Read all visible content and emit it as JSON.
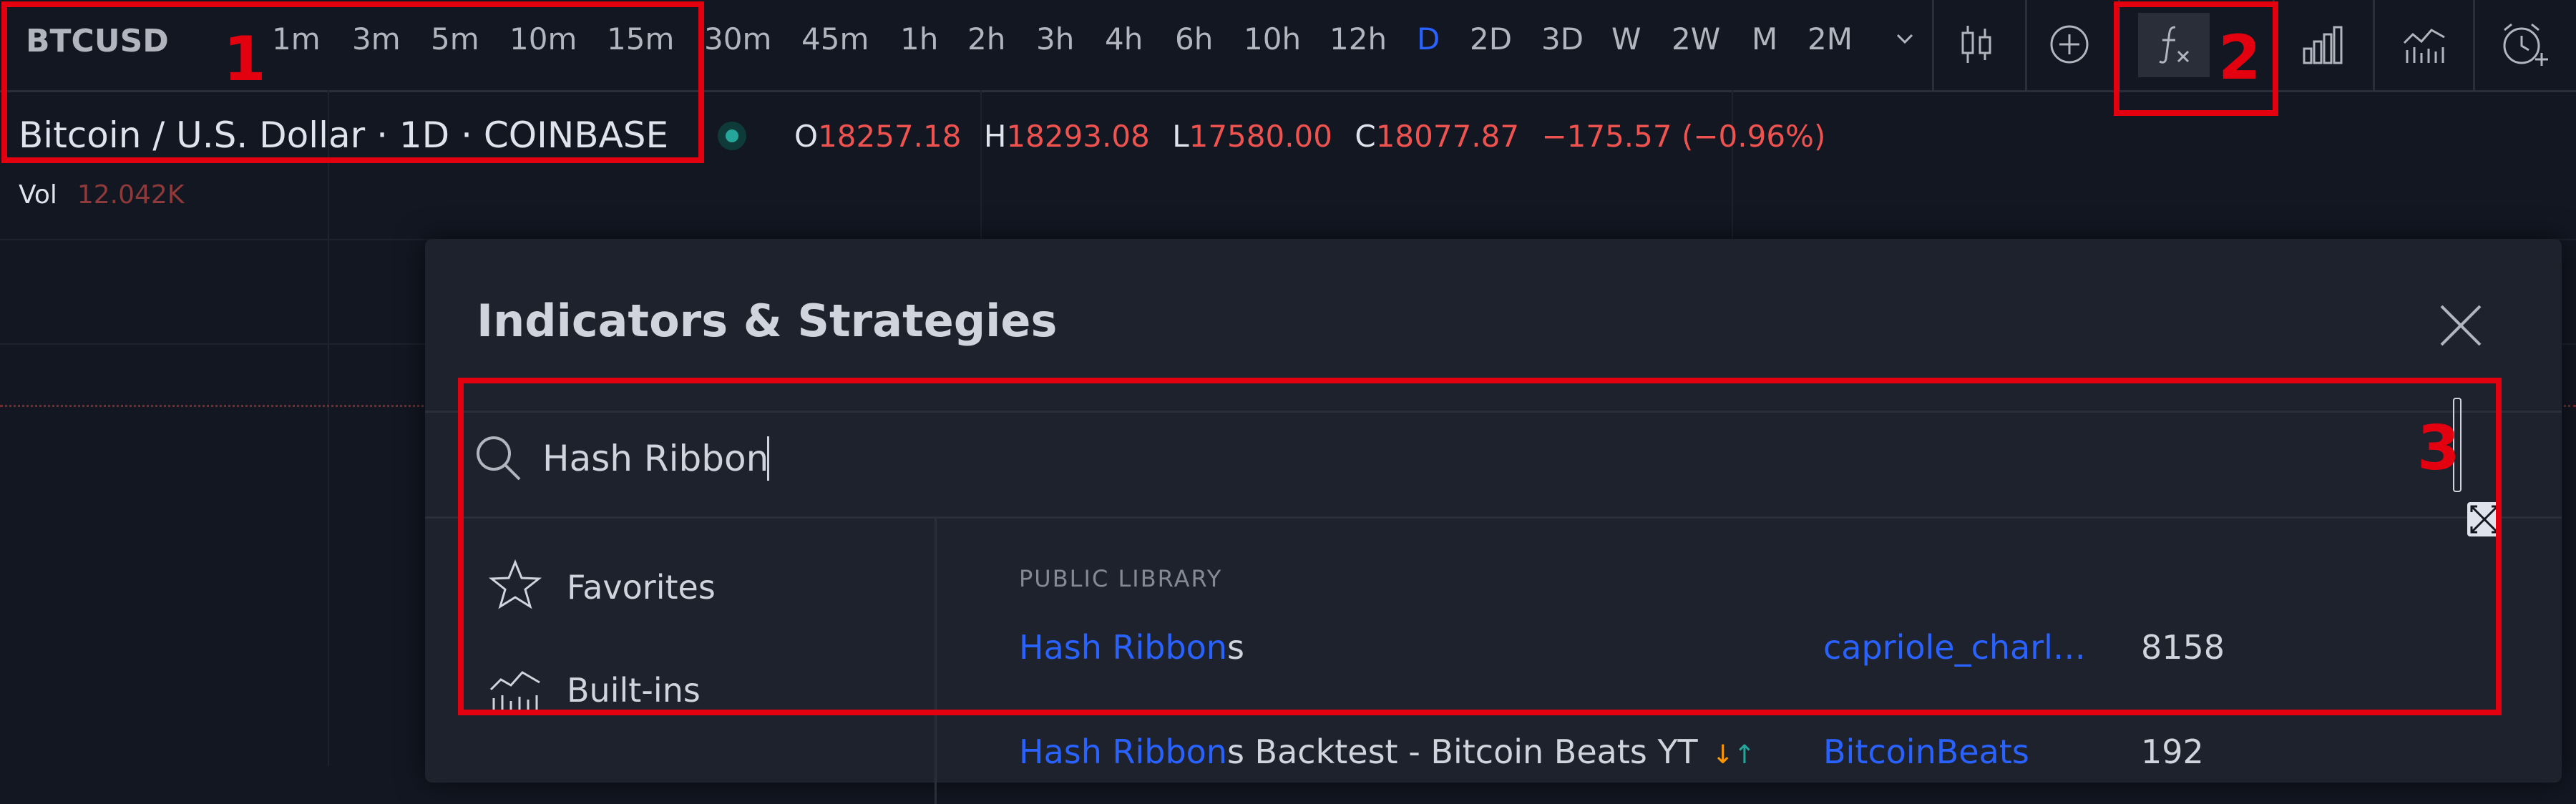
{
  "toolbar": {
    "symbol": "BTCUSD",
    "intervals": [
      "1m",
      "3m",
      "5m",
      "10m",
      "15m",
      "30m",
      "45m",
      "1h",
      "2h",
      "3h",
      "4h",
      "6h",
      "10h",
      "12h",
      "D",
      "2D",
      "3D",
      "W",
      "2W",
      "M",
      "2M"
    ],
    "active_interval": "D",
    "icons": [
      "candles-icon",
      "add-compare-icon",
      "indicators-fx-icon",
      "bar-chart-icon",
      "indicator-templates-icon",
      "alert-clock-icon"
    ]
  },
  "legend": {
    "title": "Bitcoin / U.S. Dollar · 1D · COINBASE",
    "open_label": "O",
    "open": "18257.18",
    "high_label": "H",
    "high": "18293.08",
    "low_label": "L",
    "low": "17580.00",
    "close_label": "C",
    "close": "18077.87",
    "change": "−175.57 (−0.96%)",
    "vol_label": "Vol",
    "vol": "12.042K"
  },
  "dialog": {
    "title": "Indicators & Strategies",
    "search_value": "Hash Ribbon",
    "categories": [
      {
        "label": "Favorites",
        "icon": "star-icon"
      },
      {
        "label": "Built-ins",
        "icon": "built-ins-icon"
      }
    ],
    "section_label": "PUBLIC LIBRARY",
    "results": [
      {
        "match": "Hash Ribbon",
        "rest": "s",
        "author": "capriole_charl…",
        "count": "8158",
        "arrows": ""
      },
      {
        "match": "Hash Ribbon",
        "rest": "s Backtest - Bitcoin Beats YT",
        "author": "BitcoinBeats",
        "count": "192",
        "arrows": "↓↑"
      }
    ]
  },
  "annotations": [
    "1",
    "2",
    "3"
  ],
  "colors": {
    "background": "#131722",
    "panel": "#1e222d",
    "accent_blue": "#2962ff",
    "price_red": "#ef5350",
    "annotation_red": "#e3000f"
  }
}
